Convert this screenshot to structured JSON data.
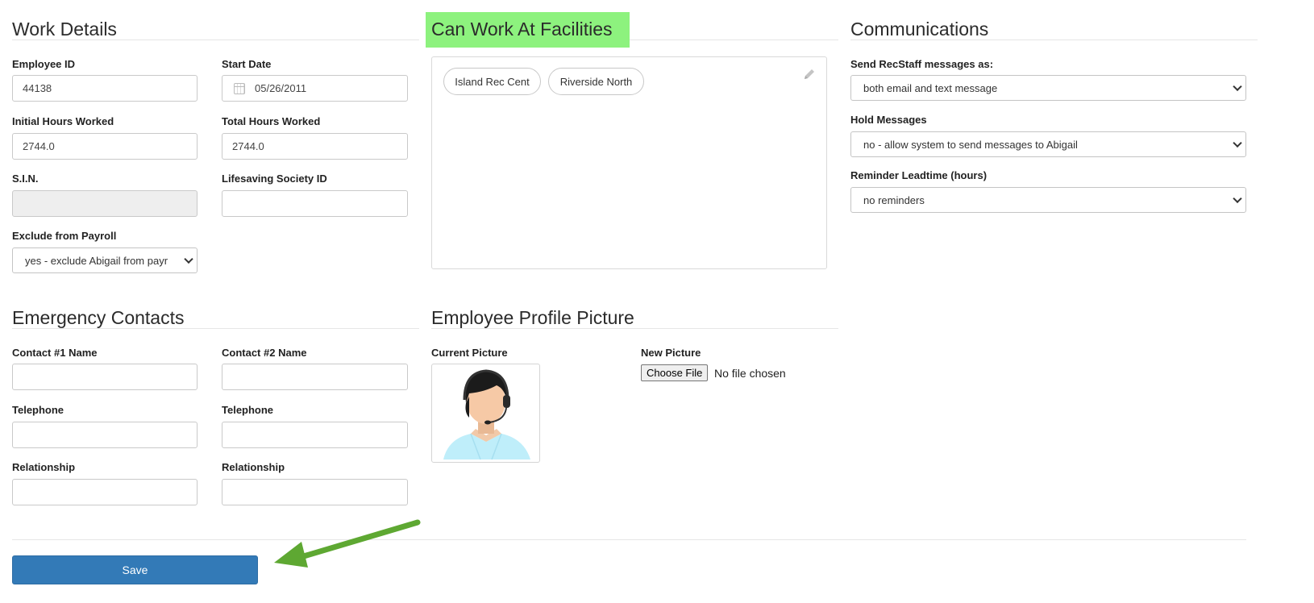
{
  "work_details": {
    "title": "Work Details",
    "employee_id_label": "Employee ID",
    "employee_id_value": "44138",
    "start_date_label": "Start Date",
    "start_date_value": "05/26/2011",
    "initial_hours_label": "Initial Hours Worked",
    "initial_hours_value": "2744.0",
    "total_hours_label": "Total Hours Worked",
    "total_hours_value": "2744.0",
    "sin_label": "S.I.N.",
    "sin_value": "",
    "lifesaving_label": "Lifesaving Society ID",
    "lifesaving_value": "",
    "exclude_payroll_label": "Exclude from Payroll",
    "exclude_payroll_value": "yes - exclude Abigail from payr"
  },
  "facilities": {
    "title": "Can Work At Facilities",
    "highlight_color": "#8df27e",
    "items": [
      "Island Rec Cent",
      "Riverside North"
    ]
  },
  "communications": {
    "title": "Communications",
    "send_label": "Send RecStaff messages as:",
    "send_value": "both email and text message",
    "hold_label": "Hold Messages",
    "hold_value": "no - allow system to send messages to Abigail",
    "reminder_label": "Reminder Leadtime (hours)",
    "reminder_value": "no reminders"
  },
  "emergency": {
    "title": "Emergency Contacts",
    "contact1_name_label": "Contact #1 Name",
    "contact2_name_label": "Contact #2 Name",
    "telephone1_label": "Telephone",
    "telephone2_label": "Telephone",
    "relationship1_label": "Relationship",
    "relationship2_label": "Relationship"
  },
  "profile_picture": {
    "title": "Employee Profile Picture",
    "current_label": "Current Picture",
    "new_label": "New Picture",
    "choose_file_label": "Choose File",
    "no_file_text": "No file chosen"
  },
  "footer": {
    "save_label": "Save",
    "save_color": "#337ab7",
    "arrow_color": "#5ea832"
  }
}
